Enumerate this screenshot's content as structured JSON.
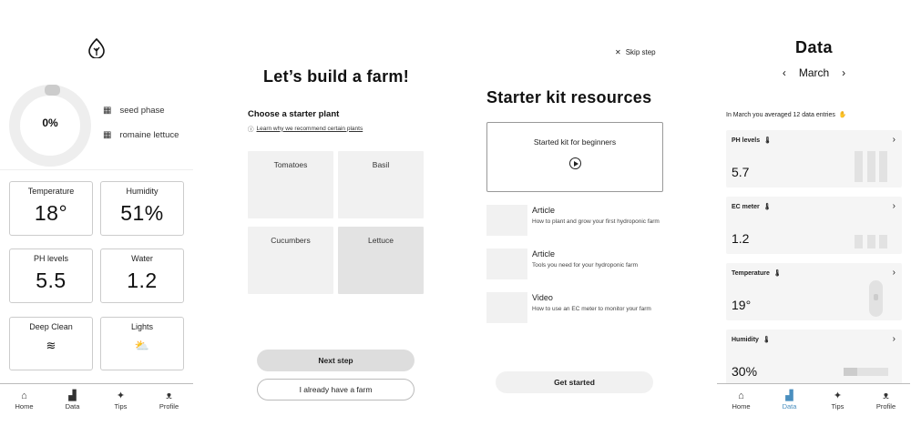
{
  "screen1": {
    "progress": {
      "percent_label": "0%",
      "value": 0
    },
    "phase": [
      {
        "icon": "plant-grid-icon",
        "label": "seed phase"
      },
      {
        "icon": "plant-grid-icon",
        "label": "romaine lettuce"
      }
    ],
    "cards": [
      {
        "label": "Temperature",
        "value": "18°"
      },
      {
        "label": "Humidity",
        "value": "51%"
      },
      {
        "label": "PH levels",
        "value": "5.5"
      },
      {
        "label": "Water",
        "value": "1.2"
      },
      {
        "label": "Deep Clean",
        "icon": "waves-icon",
        "glyph": "≋"
      },
      {
        "label": "Lights",
        "icon": "sunrise-icon",
        "glyph": "⛅"
      }
    ]
  },
  "tabs": [
    {
      "label": "Home",
      "icon": "home-icon",
      "glyph": "⌂"
    },
    {
      "label": "Data",
      "icon": "chart-icon",
      "glyph": "▟"
    },
    {
      "label": "Tips",
      "icon": "sparkle-icon",
      "glyph": "✦"
    },
    {
      "label": "Profile",
      "icon": "profile-icon",
      "glyph": "ᴥ"
    }
  ],
  "screen2": {
    "title": "Let’s build a farm!",
    "subtitle": "Choose a starter plant",
    "link": "Learn why we recommend certain plants",
    "plants": [
      "Tomatoes",
      "Basil",
      "Cucumbers",
      "Lettuce"
    ],
    "selected_plant": "Lettuce",
    "next_button": "Next step",
    "have_farm_button": "I already have a farm"
  },
  "screen3": {
    "skip": "Skip step",
    "title": "Starter kit resources",
    "kit_label": "Started kit for beginners",
    "resources": [
      {
        "type": "Article",
        "desc": "How to plant and grow your first hydroponic farm"
      },
      {
        "type": "Article",
        "desc": "Tools you need for your hydroponic farm"
      },
      {
        "type": "Video",
        "desc": "How to use an EC meter to monitor your farm"
      }
    ],
    "get_started": "Get started"
  },
  "screen4": {
    "title": "Data",
    "month": "March",
    "avg_text": "In March you averaged 12 data entries",
    "cards": [
      {
        "label": "PH levels",
        "value": "5.7"
      },
      {
        "label": "EC meter",
        "value": "1.2"
      },
      {
        "label": "Temperature",
        "value": "19°"
      },
      {
        "label": "Humidity",
        "value": "30%"
      }
    ],
    "active_tab": "Data",
    "accent": "#4a8fbf"
  }
}
